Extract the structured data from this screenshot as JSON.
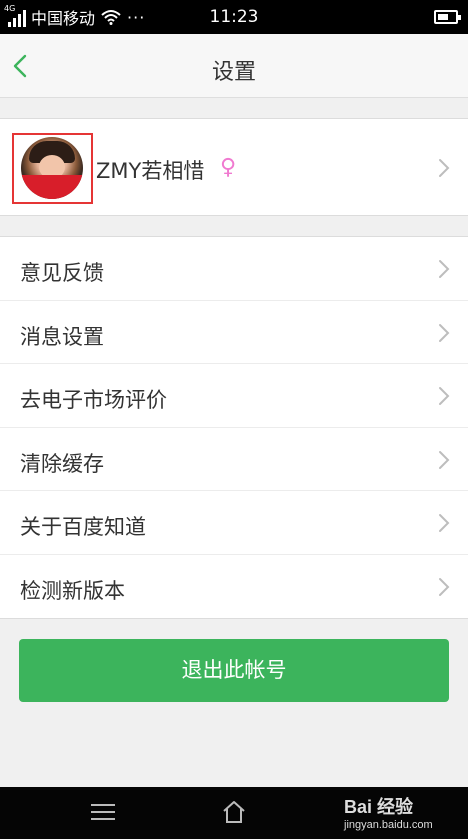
{
  "status_bar": {
    "network": "4G",
    "carrier": "中国移动",
    "more": "···",
    "time": "11:23",
    "battery_level": 0.6
  },
  "header": {
    "title": "设置",
    "back_icon": "chevron-left-icon"
  },
  "profile": {
    "username": "ZMY若相惜",
    "gender_symbol": "♀",
    "avatar_icon": "user-avatar"
  },
  "menu": {
    "items": [
      {
        "label": "意见反馈"
      },
      {
        "label": "消息设置"
      },
      {
        "label": "去电子市场评价"
      },
      {
        "label": "清除缓存"
      },
      {
        "label": "关于百度知道"
      },
      {
        "label": "检测新版本"
      }
    ]
  },
  "logout": {
    "label": "退出此帐号"
  },
  "colors": {
    "accent_green": "#3cb45c",
    "highlight_red": "#e53535",
    "gender_pink": "#f07ad0"
  },
  "watermark": {
    "brand": "Bai 经验",
    "site": "jingyan.baidu.com"
  }
}
